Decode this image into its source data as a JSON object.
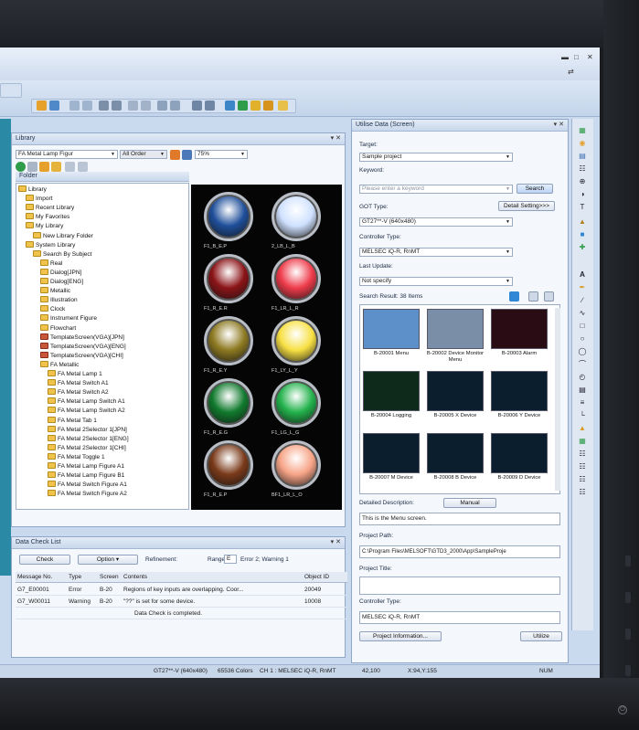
{
  "library": {
    "title": "Library",
    "combo_value": "FA Metal Lamp Figur",
    "sort_value": "All Order",
    "zoom": "75%",
    "folder_header": "Folder",
    "tree": [
      {
        "label": "Library",
        "indent": 0
      },
      {
        "label": "Import",
        "indent": 1
      },
      {
        "label": "Recent Library",
        "indent": 1
      },
      {
        "label": "My Favorites",
        "indent": 1
      },
      {
        "label": "My Library",
        "indent": 1
      },
      {
        "label": "New Library Folder",
        "indent": 2
      },
      {
        "label": "System Library",
        "indent": 1
      },
      {
        "label": "Search By Subject",
        "indent": 2
      },
      {
        "label": "Real",
        "indent": 3
      },
      {
        "label": "Dialog[JPN]",
        "indent": 3
      },
      {
        "label": "Dialog[ENG]",
        "indent": 3
      },
      {
        "label": "Metallic",
        "indent": 3
      },
      {
        "label": "Illustration",
        "indent": 3
      },
      {
        "label": "Clock",
        "indent": 3
      },
      {
        "label": "Instrument Figure",
        "indent": 3
      },
      {
        "label": "Flowchart",
        "indent": 3
      },
      {
        "label": "TemplateScreen(VGA)[JPN]",
        "indent": 3
      },
      {
        "label": "TemplateScreen(VGA)[ENG]",
        "indent": 3
      },
      {
        "label": "TemplateScreen(VGA)[CHI]",
        "indent": 3
      },
      {
        "label": "FA Metallic",
        "indent": 3
      },
      {
        "label": "FA Metal Lamp 1",
        "indent": 4
      },
      {
        "label": "FA Metal Switch A1",
        "indent": 4
      },
      {
        "label": "FA Metal Switch A2",
        "indent": 4
      },
      {
        "label": "FA Metal Lamp Switch A1",
        "indent": 4
      },
      {
        "label": "FA Metal Lamp Switch A2",
        "indent": 4
      },
      {
        "label": "FA Metal Tab 1",
        "indent": 4
      },
      {
        "label": "FA Metal 2Selector 1[JPN]",
        "indent": 4
      },
      {
        "label": "FA Metal 2Selector 1[ENG]",
        "indent": 4
      },
      {
        "label": "FA Metal 2Selector 1[CHI]",
        "indent": 4
      },
      {
        "label": "FA Metal Toggle 1",
        "indent": 4
      },
      {
        "label": "FA Metal Lamp Figure A1",
        "indent": 4
      },
      {
        "label": "FA Metal Lamp Figure B1",
        "indent": 4
      },
      {
        "label": "FA Metal Switch Figure A1",
        "indent": 4
      },
      {
        "label": "FA Metal Switch Figure A2",
        "indent": 4
      }
    ],
    "lamps": [
      {
        "label": "F1_B_E.P",
        "color": "#1f4f9a"
      },
      {
        "label": "2_LB_L_B",
        "color": "#cfe1ff"
      },
      {
        "label": "F1_R_E.R",
        "color": "#8b1418"
      },
      {
        "label": "F1_LR_L_R",
        "color": "#ee3b4a"
      },
      {
        "label": "F1_R_E.Y",
        "color": "#8e7a22"
      },
      {
        "label": "F1_LY_L_Y",
        "color": "#f7e043"
      },
      {
        "label": "F1_R_E.G",
        "color": "#117a2e"
      },
      {
        "label": "F1_LG_L_G",
        "color": "#23b24c"
      },
      {
        "label": "F1_R_E.P",
        "color": "#7a3a1a"
      },
      {
        "label": "BF1_LR_L_O",
        "color": "#f7a487"
      }
    ]
  },
  "utility": {
    "title": "Utilise Data (Screen)",
    "target_label": "Target:",
    "target_value": "Sample project",
    "keyword_label": "Keyword:",
    "keyword_placeholder": "Please enter a keyword",
    "search_button": "Search",
    "got_type_label": "GOT Type:",
    "detail_button": "Detail Setting>>>",
    "got_type_value": "GT27**-V (640x480)",
    "controller_label": "Controller Type:",
    "controller_value": "MELSEC iQ-R, RnMT",
    "last_update_label": "Last Update:",
    "last_update_value": "Not specify",
    "result_label": "Search Result: 38 Items",
    "thumbs": [
      {
        "caption": "B-20001 Menu"
      },
      {
        "caption": "B-20002 Device Monitor Menu"
      },
      {
        "caption": "B-20003 Alarm"
      },
      {
        "caption": "B-20004 Logging"
      },
      {
        "caption": "B-20005 X Device"
      },
      {
        "caption": "B-20006 Y Device"
      },
      {
        "caption": "B-20007 M Device"
      },
      {
        "caption": "B-20008 B Device"
      },
      {
        "caption": "B-20009 D Device"
      }
    ],
    "detail_label": "Detailed Description:",
    "manual_button": "Manual",
    "detail_value": "This is the Menu screen.",
    "path_label": "Project Path:",
    "path_value": "C:\\Program Files\\MELSOFT\\GTD3_2000\\App\\SampleProje",
    "project_title_label": "Project Title:",
    "ctrl_type_label2": "Controller Type:",
    "ctrl_type_value2": "MELSEC iQ-R, RnMT",
    "project_info_button": "Project Information...",
    "utilize_button": "Utilize"
  },
  "datacheck": {
    "title": "Data Check List",
    "check_button": "Check",
    "option_button": "Option",
    "refinement_label": "Refinement:",
    "range_label": "Range",
    "range_value": "E",
    "summary": "Error 2; Warning 1",
    "columns": [
      "Message No.",
      "Type",
      "Screen",
      "Contents",
      "Object ID"
    ],
    "rows": [
      {
        "no": "G7_E00001",
        "type": "Error",
        "screen": "B-20",
        "contents": "Regions of key inputs are overlapping. Coor...",
        "obj": "20049"
      },
      {
        "no": "G7_W00011",
        "type": "Warning",
        "screen": "B-20",
        "contents": "\"??\" is set for some device.",
        "obj": "10008"
      },
      {
        "no": "",
        "type": "",
        "screen": "",
        "contents": "Data Check is completed.",
        "obj": ""
      }
    ]
  },
  "status": {
    "got": "GT27**-V (640x480)",
    "colors": "65536 Colors",
    "ch": "CH 1 : MELSEC iQ-R, RnMT",
    "coord1": "42,100",
    "coord2": "X:94,Y:155",
    "num": "NUM"
  }
}
